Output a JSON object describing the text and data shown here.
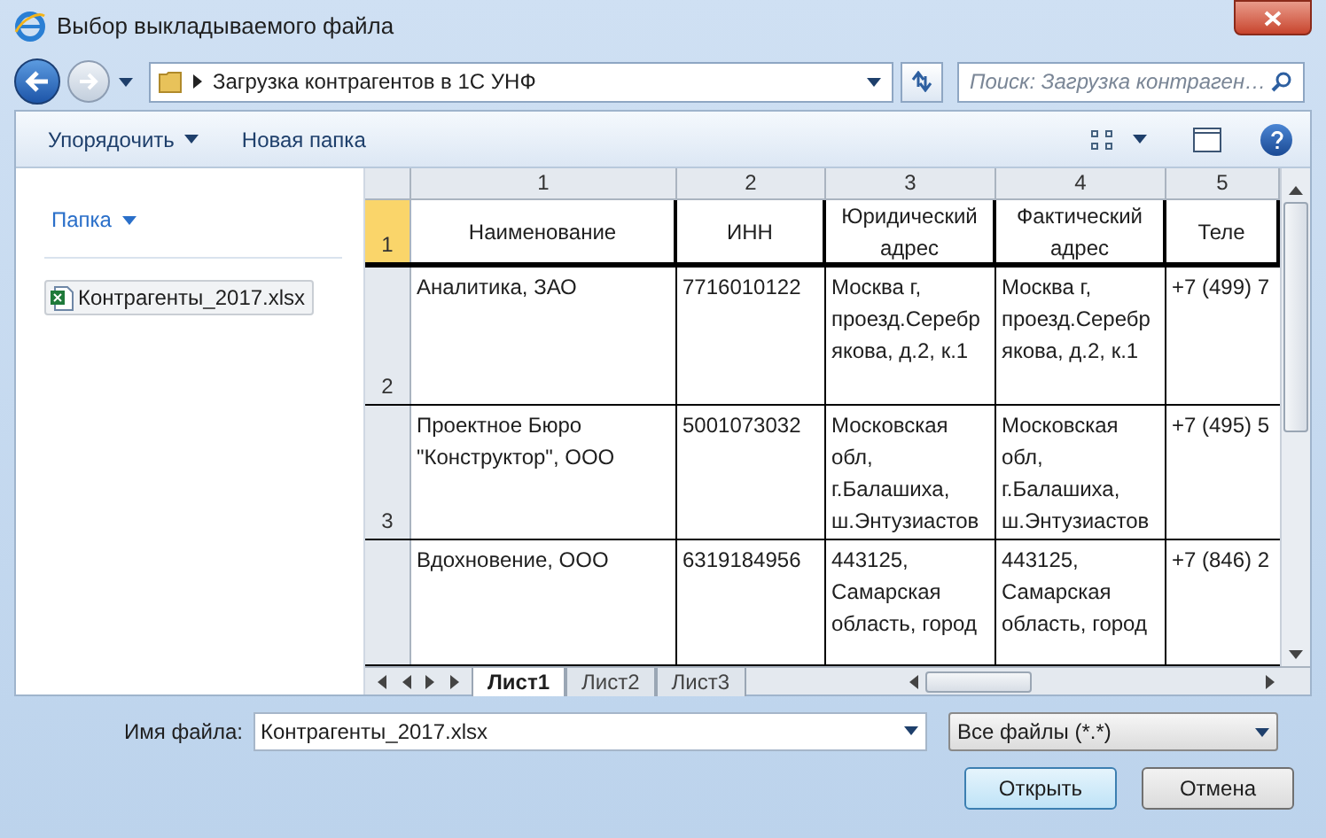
{
  "window": {
    "title": "Выбор выкладываемого файла"
  },
  "address": {
    "path": "Загрузка контрагентов в 1С УНФ"
  },
  "search": {
    "placeholder": "Поиск: Загрузка контраген…"
  },
  "toolbar": {
    "organize": "Упорядочить",
    "new_folder": "Новая папка"
  },
  "sidebar": {
    "folder_link": "Папка",
    "files": [
      {
        "name": "Контрагенты_2017.xlsx",
        "selected": true
      }
    ]
  },
  "sheet": {
    "columns": [
      "1",
      "2",
      "3",
      "4",
      "5"
    ],
    "rows": [
      {
        "number": "1",
        "selected": true,
        "kind": "header",
        "cells": [
          "Наименование",
          "ИНН",
          "Юридический адрес",
          "Фактический адрес",
          "Теле"
        ]
      },
      {
        "number": "2",
        "selected": false,
        "kind": "data",
        "cells": [
          "Аналитика, ЗАО",
          "7716010122",
          "Москва г, проезд.Серебрякова, д.2, к.1",
          "Москва г, проезд.Серебрякова, д.2, к.1",
          "+7 (499) 7"
        ]
      },
      {
        "number": "3",
        "selected": false,
        "kind": "data",
        "cells": [
          "Проектное Бюро \"Конструктор\", ООО",
          "5001073032",
          "Московская обл, г.Балашиха, ш.Энтузиастов",
          "Московская обл, г.Балашиха, ш.Энтузиастов",
          "+7 (495) 5"
        ]
      },
      {
        "selected": false,
        "kind": "data",
        "cells": [
          "Вдохновение, ООО",
          "6319184956",
          "443125, Самарская область, город",
          "443125, Самарская область, город",
          "+7 (846) 2"
        ]
      }
    ],
    "tabs": [
      {
        "label": "Лист1",
        "selected": true
      },
      {
        "label": "Лист2",
        "selected": false
      },
      {
        "label": "Лист3",
        "selected": false
      }
    ]
  },
  "file_name": {
    "label": "Имя файла:",
    "value": "Контрагенты_2017.xlsx"
  },
  "file_type": {
    "value": "Все файлы (*.*)"
  },
  "buttons": [
    {
      "label": "Открыть",
      "kind": "primary"
    },
    {
      "label": "Отмена",
      "kind": "default"
    }
  ]
}
